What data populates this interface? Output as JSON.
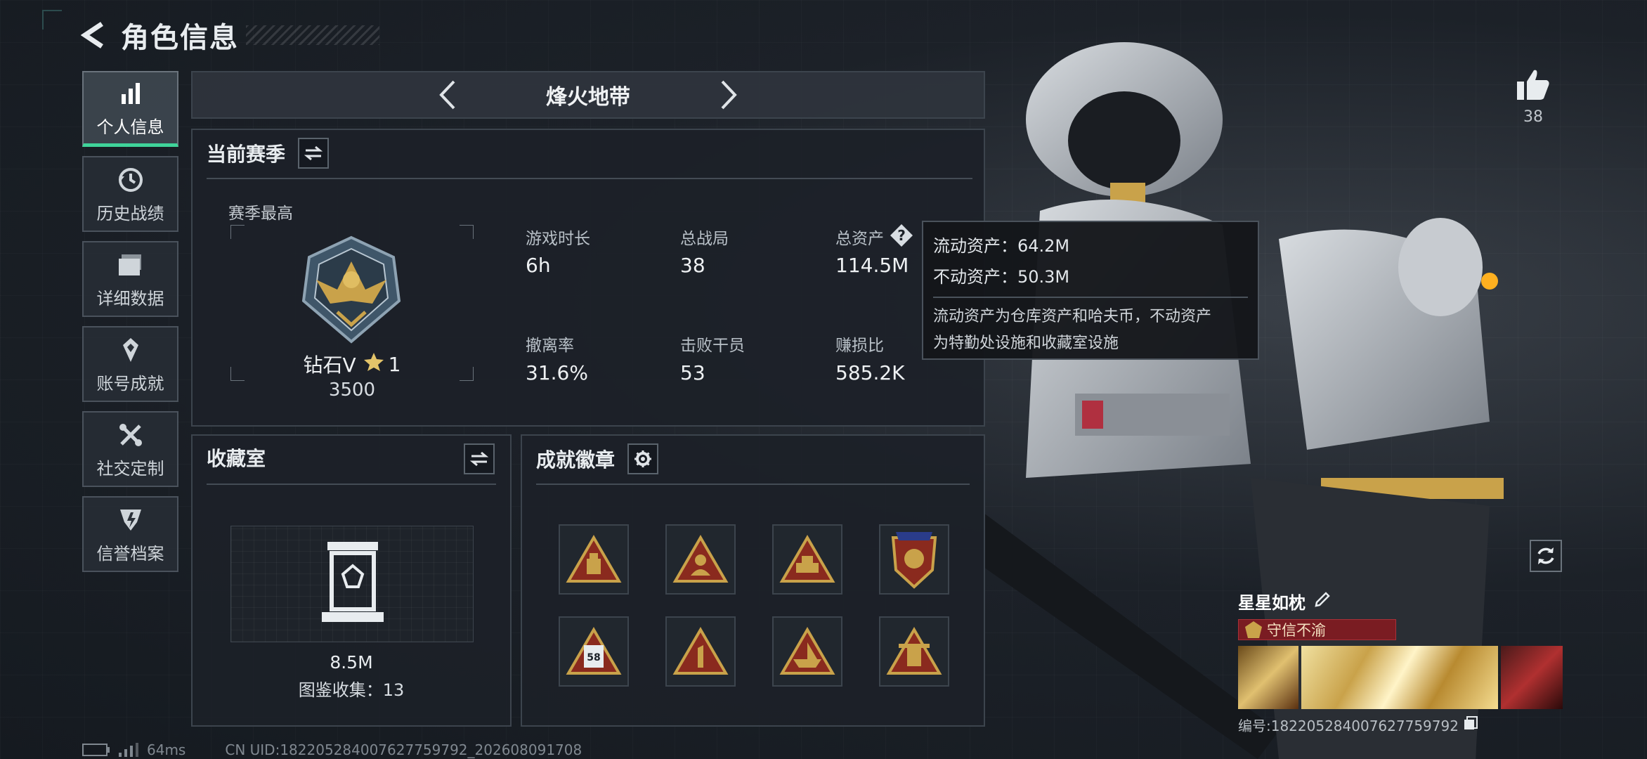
{
  "header": {
    "title": "角色信息"
  },
  "sidebar": {
    "items": [
      {
        "label": "个人信息",
        "icon": "bar-chart-icon",
        "active": true
      },
      {
        "label": "历史战绩",
        "icon": "history-clock-icon"
      },
      {
        "label": "详细数据",
        "icon": "folder-data-icon"
      },
      {
        "label": "账号成就",
        "icon": "achievement-icon"
      },
      {
        "label": "社交定制",
        "icon": "tools-icon"
      },
      {
        "label": "信誉档案",
        "icon": "credit-shield-icon"
      }
    ]
  },
  "mode": {
    "name": "烽火地带"
  },
  "season": {
    "title": "当前赛季",
    "best_label": "赛季最高",
    "rank": "钻石V",
    "rank_stars": "1",
    "rank_score": "3500",
    "stats": [
      {
        "label": "游戏时长",
        "value": "6h"
      },
      {
        "label": "总战局",
        "value": "38"
      },
      {
        "label": "总资产",
        "value": "114.5M"
      },
      {
        "label": "撤离率",
        "value": "31.6%"
      },
      {
        "label": "击败干员",
        "value": "53"
      },
      {
        "label": "赚损比",
        "value": "585.2K"
      }
    ]
  },
  "tooltip": {
    "liquid": "流动资产：64.2M",
    "fixed": "不动资产：50.3M",
    "desc_line1": "流动资产为仓库资产和哈夫币，不动资产",
    "desc_line2": "为特勤处设施和收藏室设施"
  },
  "collection": {
    "title": "收藏室",
    "value": "8.5M",
    "count_label": "图鉴收集：13"
  },
  "badges": {
    "title": "成就徽章",
    "count": 8
  },
  "player": {
    "name": "星星如枕",
    "title_tag": "守信不渝",
    "id_text": "编号:1822052840076277597​92",
    "likes": "38"
  },
  "status": {
    "ping": "64ms",
    "uid": "CN UID:1822052840076277597​92_202608091708"
  },
  "colors": {
    "accent": "#3fd49a",
    "rank_red": "#7a1c22",
    "badge_red": "#8a2a1e",
    "badge_gold": "#c9a24a"
  }
}
